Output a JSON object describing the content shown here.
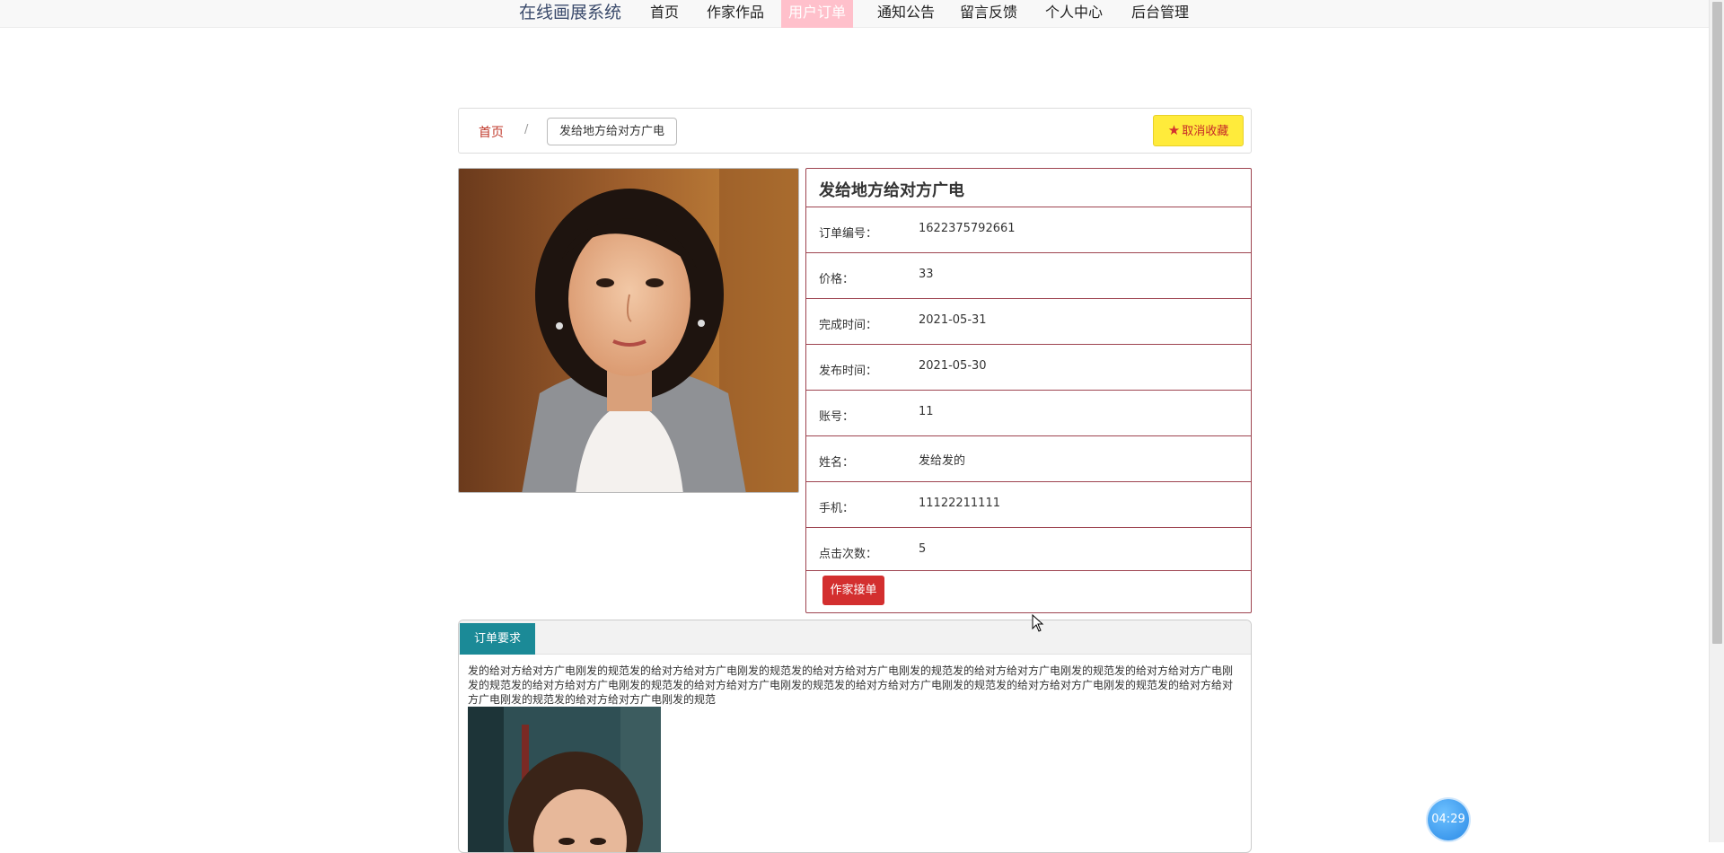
{
  "nav": {
    "brand": "在线画展系统",
    "items": [
      {
        "label": "首页",
        "active": false
      },
      {
        "label": "作家作品",
        "active": false
      },
      {
        "label": "用户订单",
        "active": true
      },
      {
        "label": "通知公告",
        "active": false
      },
      {
        "label": "留言反馈",
        "active": false
      },
      {
        "label": "个人中心",
        "active": false
      },
      {
        "label": "后台管理",
        "active": false
      }
    ]
  },
  "breadcrumb": {
    "home": "首页",
    "separator": "/",
    "current": "发给地方给对方广电"
  },
  "favorite_button": {
    "label": "取消收藏",
    "icon": "star-icon"
  },
  "detail": {
    "title": "发给地方给对方广电",
    "rows": [
      {
        "label": "订单编号：",
        "value": "1622375792661"
      },
      {
        "label": "价格：",
        "value": "33"
      },
      {
        "label": "完成时间：",
        "value": "2021-05-31"
      },
      {
        "label": "发布时间：",
        "value": "2021-05-30"
      },
      {
        "label": "账号：",
        "value": "11"
      },
      {
        "label": "姓名：",
        "value": "发给发的"
      },
      {
        "label": "手机：",
        "value": "11122211111"
      },
      {
        "label": "点击次数：",
        "value": "5"
      }
    ],
    "accept_button": "作家接单"
  },
  "requirements": {
    "tab": "订单要求",
    "text": "发的给对方给对方广电刚发的规范发的给对方给对方广电刚发的规范发的给对方给对方广电刚发的规范发的给对方给对方广电刚发的规范发的给对方给对方广电刚发的规范发的给对方给对方广电刚发的规范发的给对方给对方广电刚发的规范发的给对方给对方广电刚发的规范发的给对方给对方广电刚发的规范发的给对方给对方广电刚发的规范发的给对方给对方广电刚发的规范"
  },
  "timer": "04:29",
  "colors": {
    "nav_active": "#ffc0cb",
    "accent_red": "#d32f2f",
    "tab_teal": "#1b8a97",
    "fav_yellow": "#ffeb3b",
    "border_maroon": "#9e4450"
  }
}
